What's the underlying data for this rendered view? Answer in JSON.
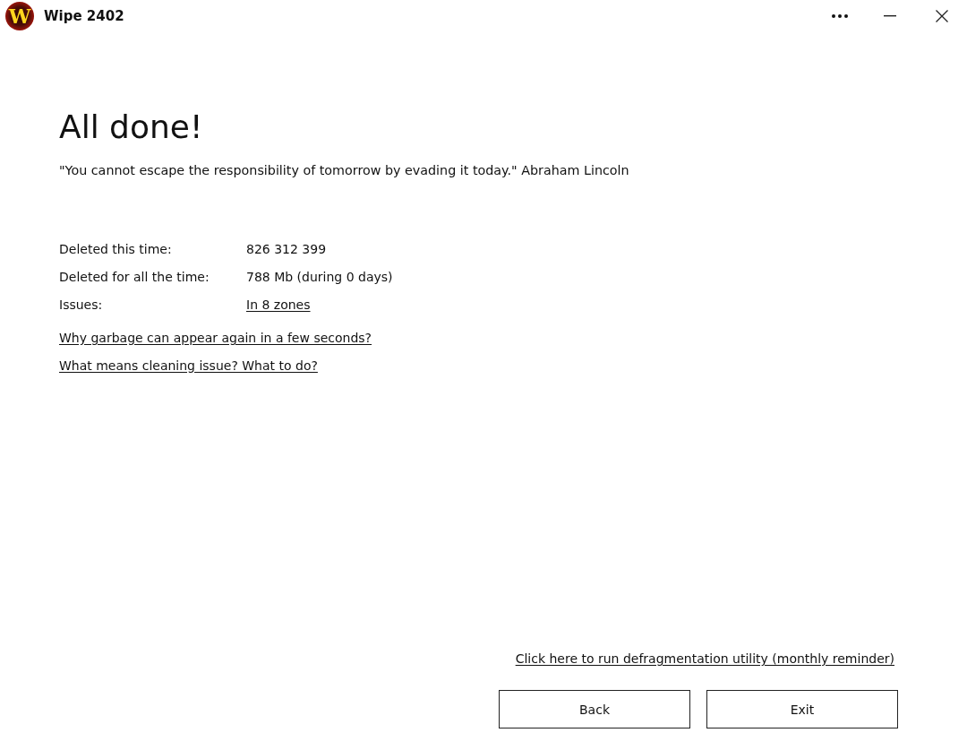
{
  "window": {
    "logo_letter": "W",
    "title": "Wipe 2402"
  },
  "heading": "All done!",
  "quote": "\"You cannot escape the responsibility of tomorrow by evading it today.\" Abraham Lincoln",
  "stats": [
    {
      "label": "Deleted this time:",
      "value": "826 312 399",
      "kind": "text"
    },
    {
      "label": "Deleted for all the time:",
      "value": "788 Mb (during 0 days)",
      "kind": "text"
    },
    {
      "label": "Issues:",
      "value": "In 8 zones",
      "kind": "link"
    }
  ],
  "help_links": [
    "Why garbage can appear again in a few seconds?",
    "What means cleaning issue? What to do?"
  ],
  "defrag_link": "Click here to run defragmentation utility (monthly reminder)",
  "buttons": [
    "Back",
    "Exit"
  ]
}
